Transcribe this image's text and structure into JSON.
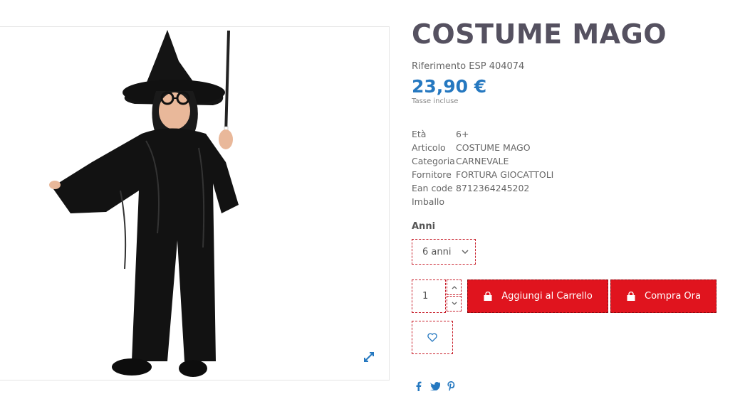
{
  "product": {
    "title": "COSTUME MAGO",
    "reference": "Riferimento ESP 404074",
    "price": "23,90 €",
    "tax_note": "Tasse incluse",
    "specs": [
      {
        "key": "Età",
        "value": "6+"
      },
      {
        "key": "Articolo",
        "value": "COSTUME MAGO"
      },
      {
        "key": "Categoria",
        "value": "CARNEVALE"
      },
      {
        "key": "Fornitore",
        "value": "FORTURA GIOCATTOLI"
      },
      {
        "key": "Ean code",
        "value": "8712364245202"
      },
      {
        "key": "Imballo",
        "value": ""
      }
    ]
  },
  "variant": {
    "label": "Anni",
    "selected": "6 anni"
  },
  "cart": {
    "quantity": "1",
    "add_label": "Aggiungi al Carrello",
    "buy_label": "Compra Ora"
  },
  "icons": {
    "expand": "expand-icon",
    "chevron": "chevron-down-icon",
    "bag": "shopping-bag-icon",
    "heart": "heart-icon",
    "facebook": "facebook-icon",
    "twitter": "twitter-icon",
    "pinterest": "pinterest-icon"
  },
  "colors": {
    "accent_red": "#e0141e",
    "price_blue": "#2578c0",
    "title": "#555160"
  }
}
